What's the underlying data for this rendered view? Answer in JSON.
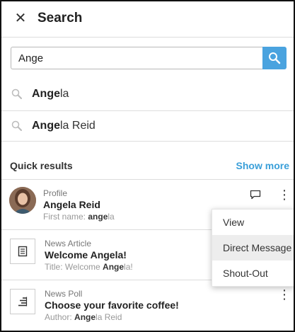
{
  "header": {
    "title": "Search",
    "close_icon": "close-icon"
  },
  "search": {
    "value": "Ange",
    "placeholder": "",
    "button_icon": "search-icon",
    "accent": "#4aa3df"
  },
  "suggestions": [
    {
      "match": "Ange",
      "rest": "la"
    },
    {
      "match": "Ange",
      "rest": "la Reid"
    }
  ],
  "quick_results": {
    "label": "Quick results",
    "show_more": "Show more",
    "items": [
      {
        "type": "Profile",
        "title": "Angela Reid",
        "sub_prefix": "First name: ",
        "sub_match": "ange",
        "sub_rest": "la"
      },
      {
        "type": "News Article",
        "title": "Welcome Angela!",
        "sub_prefix": "Title: Welcome ",
        "sub_match": "Ange",
        "sub_rest": "la!"
      },
      {
        "type": "News Poll",
        "title": "Choose your favorite coffee!",
        "sub_prefix": "Author: ",
        "sub_match": "Ange",
        "sub_rest": "la Reid"
      }
    ]
  },
  "context_menu": {
    "items": [
      "View",
      "Direct Message",
      "Shout-Out"
    ],
    "highlighted": "Direct Message"
  }
}
